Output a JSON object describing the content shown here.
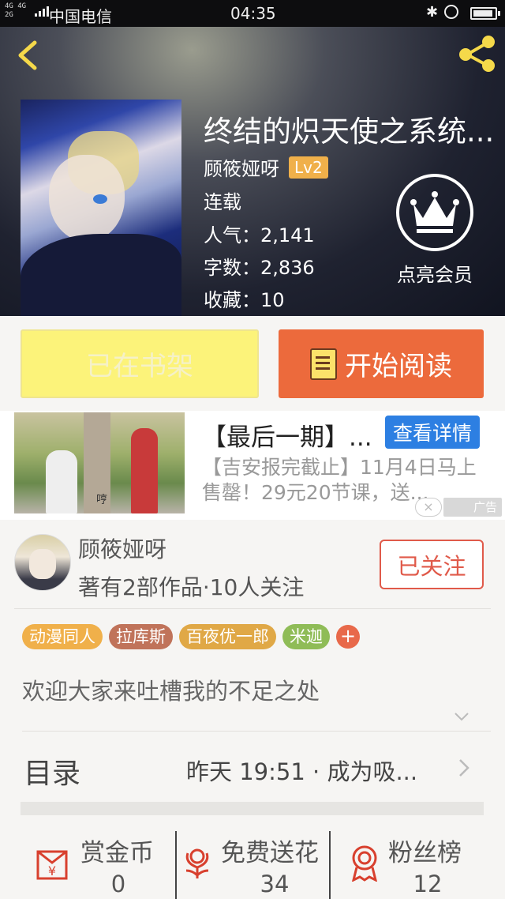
{
  "status_bar": {
    "network": "4G 4G\n2G",
    "carrier": "中国电信",
    "time": "04:35",
    "bluetooth": "✱"
  },
  "book": {
    "title": "终结的炽天使之系统...",
    "author": "顾筱娅呀",
    "level": "Lv2",
    "status": "连载",
    "popularity": "人气：2,141",
    "word_count": "字数：2,836",
    "favorites": "收藏：10"
  },
  "vip": {
    "label": "点亮会员"
  },
  "actions": {
    "shelf_label": "已在书架",
    "read_label": "开始阅读"
  },
  "ad": {
    "image_caption": "哼",
    "title": "【最后一期】...",
    "detail_label": "查看详情",
    "description": "【吉安报完截止】11月4日马上售罄！29元20节课，送...",
    "close": "×",
    "tag": "广告"
  },
  "author_card": {
    "name": "顾筱娅呀",
    "summary": "著有2部作品·10人关注",
    "follow_label": "已关注"
  },
  "tags": [
    {
      "label": "动漫同人",
      "color": "#f0b04a"
    },
    {
      "label": "拉库斯",
      "color": "#c0735a"
    },
    {
      "label": "百夜优一郎",
      "color": "#e0a846"
    },
    {
      "label": "米迦",
      "color": "#8fbc57"
    }
  ],
  "tag_add": "+",
  "intro": "欢迎大家来吐槽我的不足之处",
  "catalog": {
    "label": "目录",
    "latest": "昨天 19:51 · 成为吸..."
  },
  "stats": [
    {
      "label": "赏金币",
      "value": "0",
      "icon": "red-envelope-icon"
    },
    {
      "label": "免费送花",
      "value": "34",
      "icon": "flower-icon"
    },
    {
      "label": "粉丝榜",
      "value": "12",
      "icon": "medal-icon"
    }
  ],
  "colors": {
    "accent_orange": "#ec6a3c",
    "shelf_yellow": "#fcf37a",
    "ad_blue": "#2d7fe2",
    "follow_red": "#e05a4a",
    "icon_red": "#d8402e",
    "nav_yellow": "#f5d94a"
  }
}
